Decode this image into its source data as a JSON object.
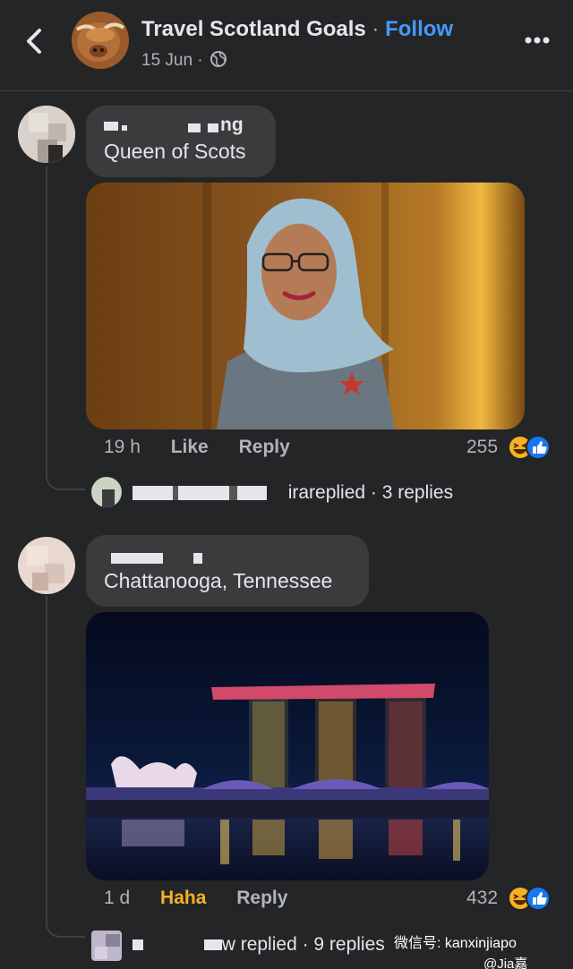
{
  "header": {
    "page_name": "Travel Scotland Goals",
    "separator": " · ",
    "follow_label": "Follow",
    "date": "15 Jun ·"
  },
  "comments": [
    {
      "text": "Queen of Scots",
      "time": "19 h",
      "like_label": "Like",
      "reply_label": "Reply",
      "reaction_count": "255",
      "reply_summary_name_fragment": "ira",
      "reply_summary": "replied · 3 replies",
      "name_fragment": "ng"
    },
    {
      "text": "Chattanooga, Tennessee",
      "time": "1 d",
      "like_label": "Haha",
      "reply_label": "Reply",
      "reaction_count": "432",
      "reply_summary_name_fragment": "w",
      "reply_summary": "replied · 9 replies"
    }
  ],
  "watermark": "微信号: kanxinjiapo",
  "watermark_sub": "@Jia嘉",
  "colors": {
    "background": "#242526",
    "bubble": "#3a3b3c",
    "follow": "#4599ff",
    "haha_active": "#f7b125"
  },
  "icons": [
    "back-chevron-icon",
    "globe-icon",
    "more-dots-icon",
    "haha-emoji-icon",
    "like-thumb-icon"
  ]
}
